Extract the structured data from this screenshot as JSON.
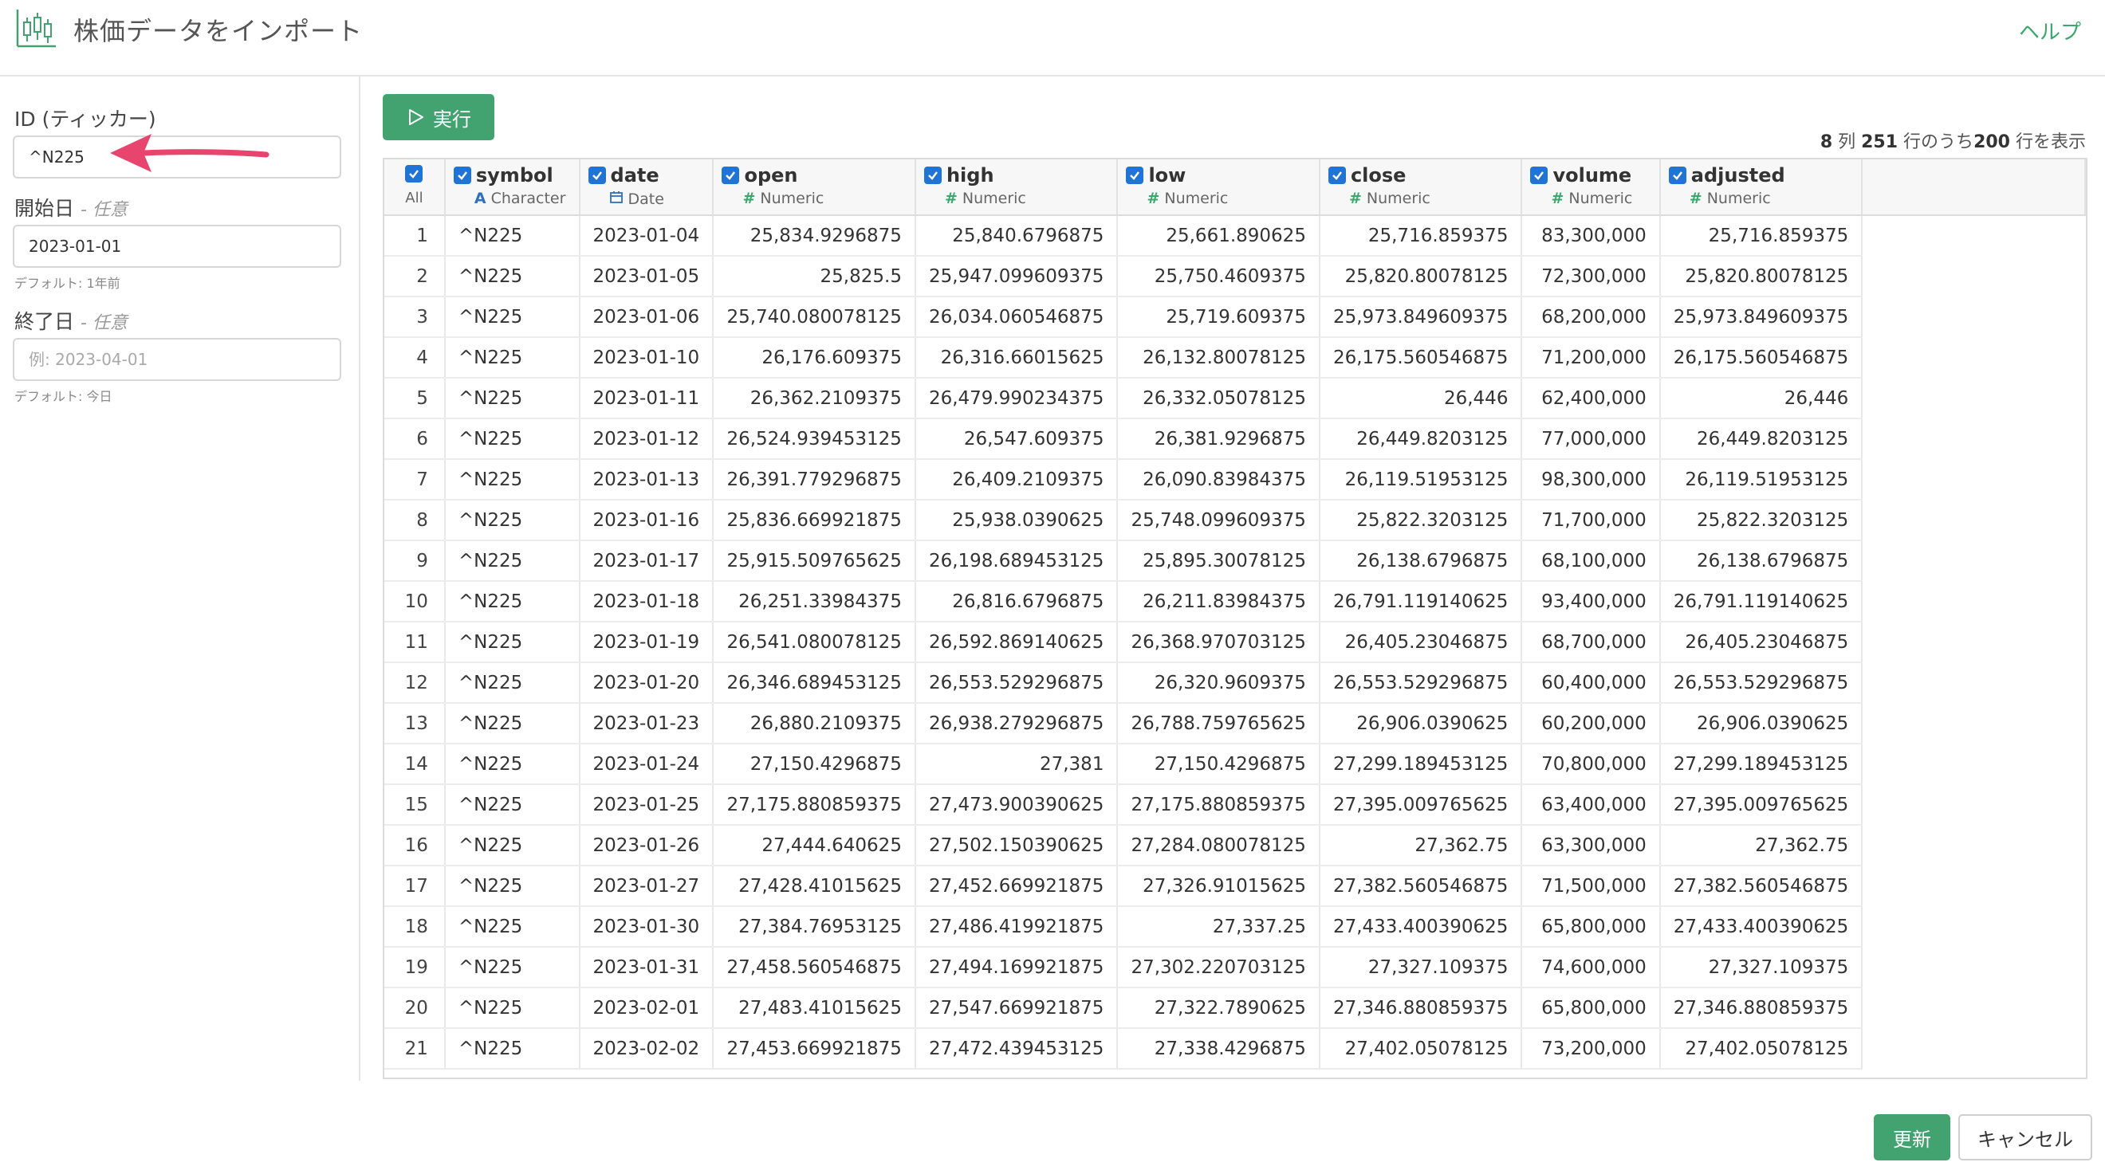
{
  "header": {
    "title": "株価データをインポート",
    "help_label": "ヘルプ"
  },
  "form": {
    "id_label": "ID (ティッカー)",
    "id_value": "^N225",
    "start_label": "開始日",
    "start_optional": "- 任意",
    "start_value": "2023-01-01",
    "start_hint": "デフォルト: 1年前",
    "end_label": "終了日",
    "end_optional": "- 任意",
    "end_placeholder": "例: 2023-04-01",
    "end_hint": "デフォルト: 今日"
  },
  "toolbar": {
    "run_label": "実行",
    "columns_count": "8",
    "columns_suffix": " 列 ",
    "total_rows": "251",
    "rows_middle": " 行のうち",
    "shown_rows": "200",
    "rows_suffix": " 行を表示"
  },
  "table": {
    "all_label": "All",
    "columns": [
      {
        "name": "symbol",
        "type": "Character",
        "type_icon": "character-icon"
      },
      {
        "name": "date",
        "type": "Date",
        "type_icon": "calendar-icon"
      },
      {
        "name": "open",
        "type": "Numeric",
        "type_icon": "hash-icon"
      },
      {
        "name": "high",
        "type": "Numeric",
        "type_icon": "hash-icon"
      },
      {
        "name": "low",
        "type": "Numeric",
        "type_icon": "hash-icon"
      },
      {
        "name": "close",
        "type": "Numeric",
        "type_icon": "hash-icon"
      },
      {
        "name": "volume",
        "type": "Numeric",
        "type_icon": "hash-icon"
      },
      {
        "name": "adjusted",
        "type": "Numeric",
        "type_icon": "hash-icon"
      }
    ],
    "rows": [
      [
        "1",
        "^N225",
        "2023-01-04",
        "25,834.9296875",
        "25,840.6796875",
        "25,661.890625",
        "25,716.859375",
        "83,300,000",
        "25,716.859375"
      ],
      [
        "2",
        "^N225",
        "2023-01-05",
        "25,825.5",
        "25,947.099609375",
        "25,750.4609375",
        "25,820.80078125",
        "72,300,000",
        "25,820.80078125"
      ],
      [
        "3",
        "^N225",
        "2023-01-06",
        "25,740.080078125",
        "26,034.060546875",
        "25,719.609375",
        "25,973.849609375",
        "68,200,000",
        "25,973.849609375"
      ],
      [
        "4",
        "^N225",
        "2023-01-10",
        "26,176.609375",
        "26,316.66015625",
        "26,132.80078125",
        "26,175.560546875",
        "71,200,000",
        "26,175.560546875"
      ],
      [
        "5",
        "^N225",
        "2023-01-11",
        "26,362.2109375",
        "26,479.990234375",
        "26,332.05078125",
        "26,446",
        "62,400,000",
        "26,446"
      ],
      [
        "6",
        "^N225",
        "2023-01-12",
        "26,524.939453125",
        "26,547.609375",
        "26,381.9296875",
        "26,449.8203125",
        "77,000,000",
        "26,449.8203125"
      ],
      [
        "7",
        "^N225",
        "2023-01-13",
        "26,391.779296875",
        "26,409.2109375",
        "26,090.83984375",
        "26,119.51953125",
        "98,300,000",
        "26,119.51953125"
      ],
      [
        "8",
        "^N225",
        "2023-01-16",
        "25,836.669921875",
        "25,938.0390625",
        "25,748.099609375",
        "25,822.3203125",
        "71,700,000",
        "25,822.3203125"
      ],
      [
        "9",
        "^N225",
        "2023-01-17",
        "25,915.509765625",
        "26,198.689453125",
        "25,895.30078125",
        "26,138.6796875",
        "68,100,000",
        "26,138.6796875"
      ],
      [
        "10",
        "^N225",
        "2023-01-18",
        "26,251.33984375",
        "26,816.6796875",
        "26,211.83984375",
        "26,791.119140625",
        "93,400,000",
        "26,791.119140625"
      ],
      [
        "11",
        "^N225",
        "2023-01-19",
        "26,541.080078125",
        "26,592.869140625",
        "26,368.970703125",
        "26,405.23046875",
        "68,700,000",
        "26,405.23046875"
      ],
      [
        "12",
        "^N225",
        "2023-01-20",
        "26,346.689453125",
        "26,553.529296875",
        "26,320.9609375",
        "26,553.529296875",
        "60,400,000",
        "26,553.529296875"
      ],
      [
        "13",
        "^N225",
        "2023-01-23",
        "26,880.2109375",
        "26,938.279296875",
        "26,788.759765625",
        "26,906.0390625",
        "60,200,000",
        "26,906.0390625"
      ],
      [
        "14",
        "^N225",
        "2023-01-24",
        "27,150.4296875",
        "27,381",
        "27,150.4296875",
        "27,299.189453125",
        "70,800,000",
        "27,299.189453125"
      ],
      [
        "15",
        "^N225",
        "2023-01-25",
        "27,175.880859375",
        "27,473.900390625",
        "27,175.880859375",
        "27,395.009765625",
        "63,400,000",
        "27,395.009765625"
      ],
      [
        "16",
        "^N225",
        "2023-01-26",
        "27,444.640625",
        "27,502.150390625",
        "27,284.080078125",
        "27,362.75",
        "63,300,000",
        "27,362.75"
      ],
      [
        "17",
        "^N225",
        "2023-01-27",
        "27,428.41015625",
        "27,452.669921875",
        "27,326.91015625",
        "27,382.560546875",
        "71,500,000",
        "27,382.560546875"
      ],
      [
        "18",
        "^N225",
        "2023-01-30",
        "27,384.76953125",
        "27,486.419921875",
        "27,337.25",
        "27,433.400390625",
        "65,800,000",
        "27,433.400390625"
      ],
      [
        "19",
        "^N225",
        "2023-01-31",
        "27,458.560546875",
        "27,494.169921875",
        "27,302.220703125",
        "27,327.109375",
        "74,600,000",
        "27,327.109375"
      ],
      [
        "20",
        "^N225",
        "2023-02-01",
        "27,483.41015625",
        "27,547.669921875",
        "27,322.7890625",
        "27,346.880859375",
        "65,800,000",
        "27,346.880859375"
      ],
      [
        "21",
        "^N225",
        "2023-02-02",
        "27,453.669921875",
        "27,472.439453125",
        "27,338.4296875",
        "27,402.05078125",
        "73,200,000",
        "27,402.05078125"
      ]
    ]
  },
  "footer": {
    "update_label": "更新",
    "cancel_label": "キャンセル"
  },
  "colors": {
    "accent_green": "#43a370",
    "checkbox_blue": "#1f74d6",
    "arrow_pink": "#e8456e"
  }
}
